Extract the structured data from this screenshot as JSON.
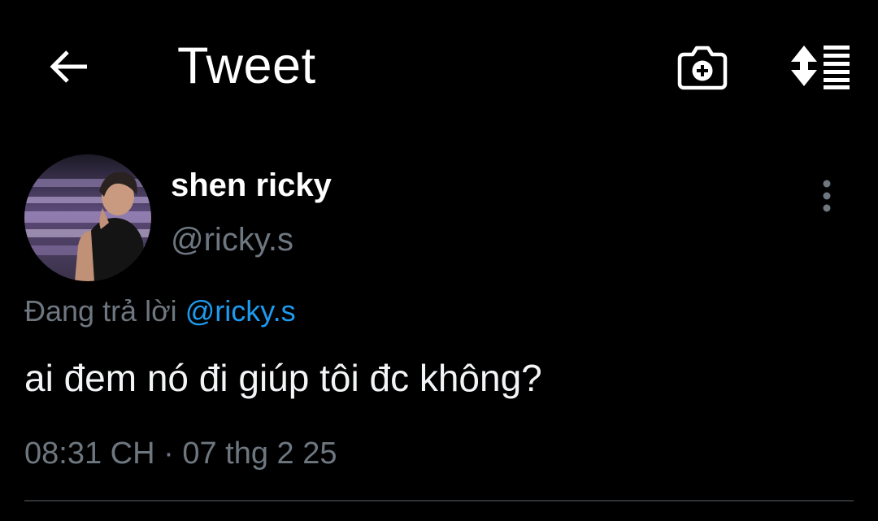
{
  "header": {
    "back_icon": "arrow-left-icon",
    "title": "Tweet",
    "camera_icon": "camera-add-icon",
    "sort_icon": "sort-list-icon"
  },
  "author": {
    "display_name": "shen ricky",
    "handle": "@ricky.s",
    "avatar": "avatar-photo",
    "more_icon": "vertical-dots-icon"
  },
  "reply": {
    "prefix": "Đang trả lời",
    "mention": "@ricky.s"
  },
  "tweet": {
    "text": "ai đem nó đi giúp tôi đc không?"
  },
  "meta": {
    "time": "08:31 CH",
    "separator": "·",
    "date": "07 thg 2 25"
  },
  "colors": {
    "background": "#000000",
    "text": "#ffffff",
    "muted": "#6e7780",
    "link": "#1d9bf0",
    "divider": "#2f3336"
  }
}
